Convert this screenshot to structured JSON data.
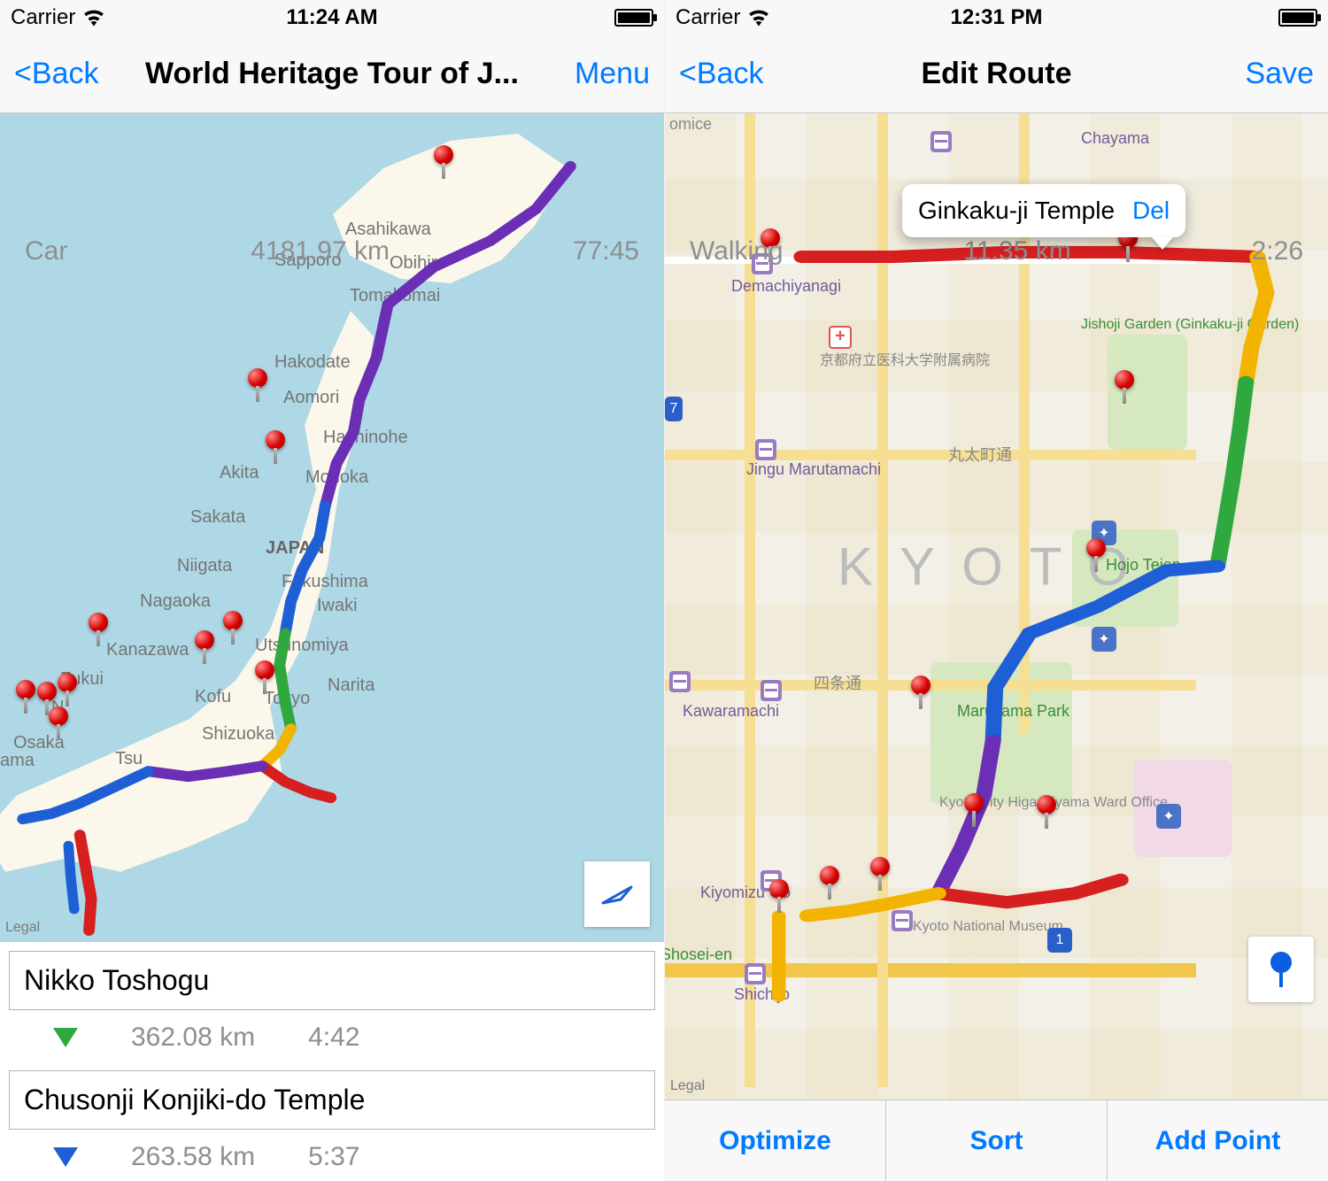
{
  "left": {
    "status": {
      "carrier": "Carrier",
      "time": "11:24 AM"
    },
    "nav": {
      "back": "Back",
      "title": "World Heritage Tour of J...",
      "right": "Menu"
    },
    "summary": {
      "mode": "Car",
      "distance": "4181.97 km",
      "duration": "77:45"
    },
    "legal": "Legal",
    "cities": [
      "Asahikawa",
      "Sapporo",
      "Obihiro",
      "Tomakomai",
      "Hakodate",
      "Aomori",
      "Hachinohe",
      "Akita",
      "Morioka",
      "Sakata",
      "JAPAN",
      "Niigata",
      "Fukushima",
      "Iwaki",
      "Nagaoka",
      "Utsunomiya",
      "Kanazawa",
      "Fukui",
      "Kofu",
      "Tokyo",
      "Narita",
      "Shizuoka",
      "Osaka",
      "Tsu",
      "ama",
      "N"
    ],
    "stops": [
      {
        "name": "Nikko Toshogu"
      },
      {
        "name": "Chusonji Konjiki-do Temple"
      }
    ],
    "legs": [
      {
        "distance": "362.08 km",
        "duration": "4:42",
        "color": "green"
      },
      {
        "distance": "263.58 km",
        "duration": "5:37",
        "color": "blue"
      }
    ]
  },
  "right": {
    "status": {
      "carrier": "Carrier",
      "time": "12:31 PM"
    },
    "nav": {
      "back": "Back",
      "title": "Edit Route",
      "right": "Save"
    },
    "summary": {
      "mode": "Walking",
      "distance": "11.35 km",
      "duration": "2:26"
    },
    "callout": {
      "title": "Ginkaku-ji Temple",
      "del": "Del"
    },
    "city": "KYOTO",
    "legal": "Legal",
    "pois": [
      "Chayama",
      "Demachiyanagi",
      "京都府立医科大学附属病院",
      "Jingu Marutamachi",
      "丸太町通",
      "Jishoji Garden (Ginkaku-ji Garden)",
      "Hojo Teien",
      "四条通",
      "Kawaramachi",
      "Maruyama Park",
      "Kyoto City Higashiyama Ward Office",
      "Kiyomizu Go",
      "Kyoto National Museum",
      "Shosei-en",
      "Shichijo",
      "omice"
    ],
    "toolbar": {
      "optimize": "Optimize",
      "sort": "Sort",
      "add": "Add Point"
    }
  }
}
